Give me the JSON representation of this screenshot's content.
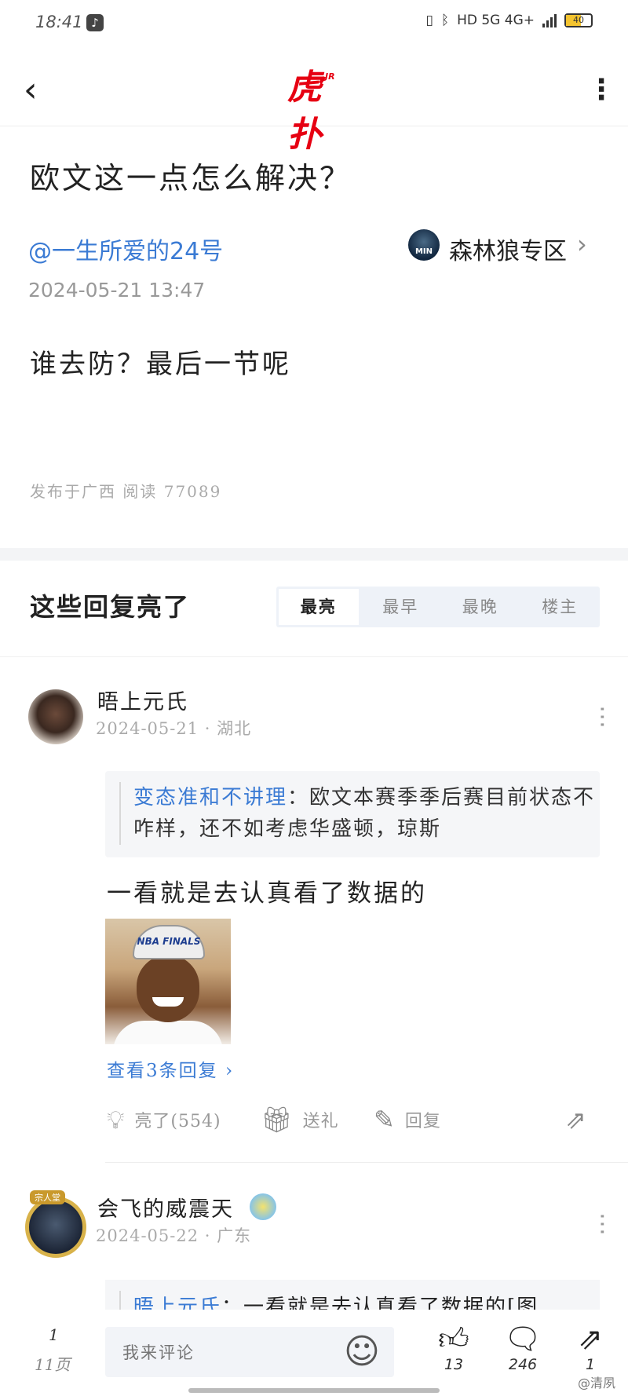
{
  "status_bar": {
    "time": "18:41",
    "app_icon": "tiktok-icon",
    "network": "HD 5G 4G+",
    "battery": "40"
  },
  "nav": {
    "back_icon": "chevron-left-icon",
    "logo_text": "虎扑",
    "logo_sup": "JR",
    "more_icon": "vertical-ellipsis-icon"
  },
  "post": {
    "title": "欧文这一点怎么解决？",
    "author": "@一生所爱的24号",
    "forum_avatar_text": "MIN",
    "forum_name": "森林狼专区",
    "date": "2024-05-21 13:47",
    "body": "谁去防？最后一节呢",
    "meta": "发布于广西  阅读 77089"
  },
  "replies_header": {
    "title": "这些回复亮了",
    "tabs": [
      "最亮",
      "最早",
      "最晚",
      "楼主"
    ],
    "active_tab": "最亮"
  },
  "reply1": {
    "username": "晤上元氏",
    "date": "2024-05-21 · 湖北",
    "quote_user": "变态准和不讲理",
    "quote_text": "：欧文本赛季季后赛目前状态不咋样，还不如考虑华盛顿，琼斯",
    "text": "一看就是去认真看了数据的",
    "image_cap_text": "NBA FINALS",
    "view_replies": "查看3条回复",
    "view_replies_chevron": "›",
    "actions": {
      "like": "亮了(554)",
      "gift": "送礼",
      "reply": "回复"
    }
  },
  "reply2": {
    "username": "会飞的威震天",
    "badge": "宗人堂",
    "date": "2024-05-22 · 广东",
    "quote_user": "晤上元氏",
    "quote_text": "：一看就是去认真看了数据的[图"
  },
  "bottom_bar": {
    "page_current": "1",
    "page_total": "11页",
    "comment_placeholder": "我来评论",
    "like_count": "13",
    "comment_count": "246",
    "share_count": "1"
  },
  "watermark": "@清夙",
  "colors": {
    "brand_red": "#e60012",
    "link_blue": "#3b7bd4",
    "tab_bg": "#eef2f8"
  }
}
